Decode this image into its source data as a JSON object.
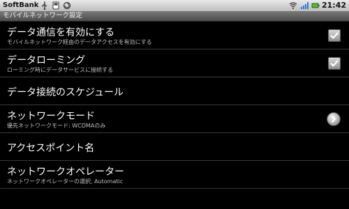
{
  "status_bar": {
    "carrier": "SoftBank",
    "time": "21:42",
    "left_icons": [
      "usb-icon",
      "sd-card-icon",
      "sync-icon"
    ],
    "right_icons": [
      "wifi-icon",
      "signal-icon",
      "battery-icon"
    ]
  },
  "title_bar": {
    "title": "モバイルネットワーク設定"
  },
  "settings": {
    "items": [
      {
        "title": "データ通信を有効にする",
        "summary": "モバイルネットワーク経由のデータアクセスを有効にする",
        "widget": "checkbox",
        "checked": true
      },
      {
        "title": "データローミング",
        "summary": "ローミング時にデータサービスに接続する",
        "widget": "checkbox",
        "checked": true
      },
      {
        "title": "データ接続のスケジュール",
        "summary": "",
        "widget": "none"
      },
      {
        "title": "ネットワークモード",
        "summary": "優先ネットワークモード: WCDMAのみ",
        "widget": "chevron"
      },
      {
        "title": "アクセスポイント名",
        "summary": "",
        "widget": "none"
      },
      {
        "title": "ネットワークオペレーター",
        "summary": "ネットワークオペレーターの選択, Automatic",
        "widget": "none"
      }
    ]
  },
  "colors": {
    "background": "#000000",
    "divider": "#3a3a3a",
    "summary_text": "#bfbfbf",
    "battery": "#4cc417",
    "signal": "#2a7bd6"
  }
}
